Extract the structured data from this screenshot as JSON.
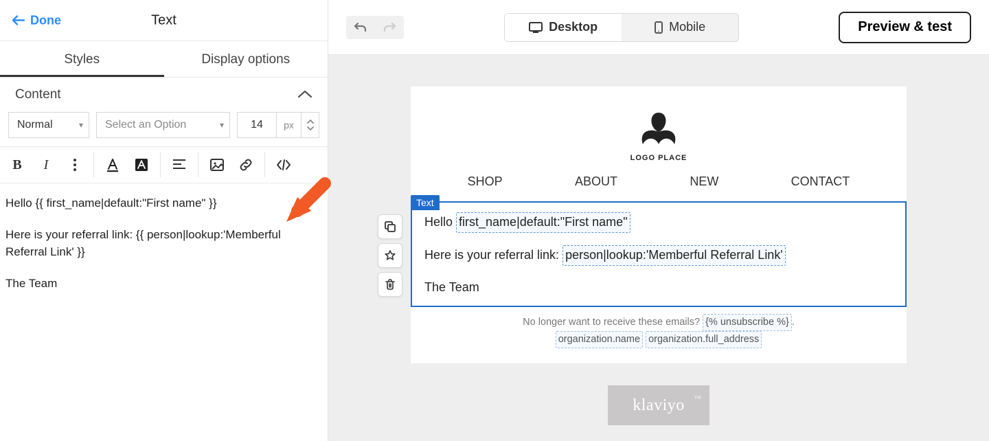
{
  "sidebar": {
    "done_label": "Done",
    "title": "Text",
    "tabs": {
      "styles": "Styles",
      "display": "Display options"
    },
    "section_content": "Content",
    "format_select": "Normal",
    "style_select_placeholder": "Select an Option",
    "font_size": "14",
    "font_unit": "px",
    "editor_line1": "Hello {{ first_name|default:\"First name\" }}",
    "editor_line2": "Here is your referral link: {{ person|lookup:'Memberful Referral Link' }}",
    "editor_line3": "The Team"
  },
  "topbar": {
    "desktop": "Desktop",
    "mobile": "Mobile",
    "preview": "Preview & test"
  },
  "email": {
    "logo_caption": "LOGO PLACE",
    "nav": [
      "SHOP",
      "ABOUT",
      "NEW",
      "CONTACT"
    ],
    "block_label": "Text",
    "line1_pre": "Hello ",
    "line1_token": "first_name|default:\"First name\"",
    "line2_pre": "Here is your referral link: ",
    "line2_token": "person|lookup:'Memberful Referral Link'",
    "line3": "The Team",
    "footer_pre": "No longer want to receive these emails? ",
    "footer_unsub": "{% unsubscribe %}",
    "footer_org_name": "organization.name",
    "footer_org_addr": "organization.full_address",
    "brand": "klaviyo"
  }
}
